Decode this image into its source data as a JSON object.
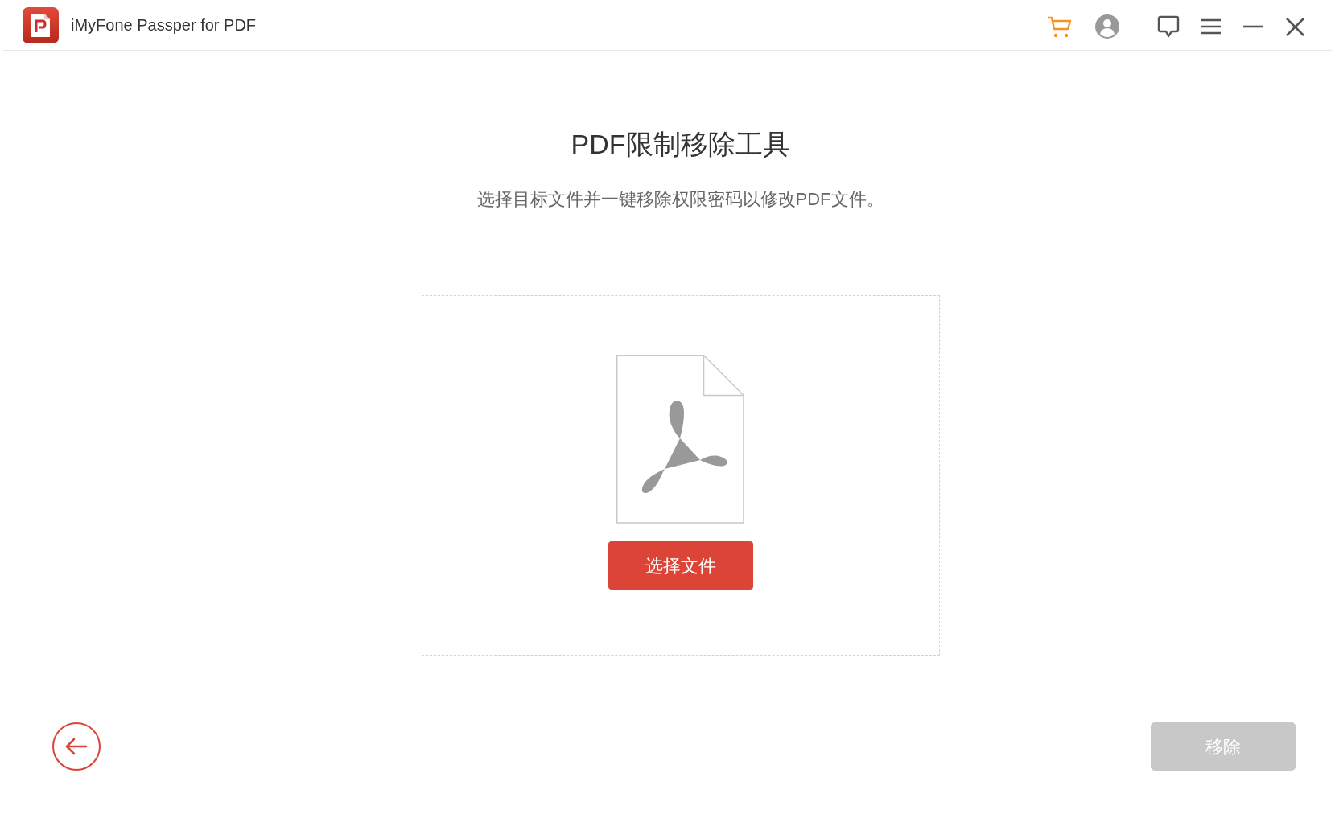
{
  "window": {
    "title": "iMyFone Passper for PDF"
  },
  "page": {
    "heading": "PDF限制移除工具",
    "subtitle": "选择目标文件并一键移除权限密码以修改PDF文件。"
  },
  "drop_area": {
    "button": "选择文件"
  },
  "footer": {
    "remove_button": {
      "label": "移除",
      "disabled": true
    }
  }
}
